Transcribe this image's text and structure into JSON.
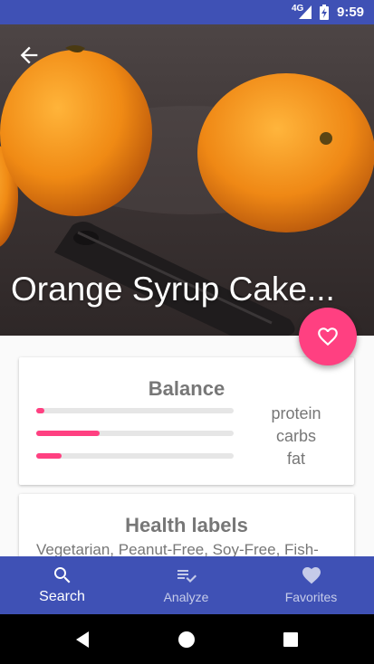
{
  "status_bar": {
    "network": "4G",
    "time": "9:59"
  },
  "recipe": {
    "title": "Orange Syrup Cake..."
  },
  "balance": {
    "title": "Balance",
    "nutrients": [
      {
        "label": "protein",
        "fraction": 0.04
      },
      {
        "label": "carbs",
        "fraction": 0.32
      },
      {
        "label": "fat",
        "fraction": 0.13
      }
    ],
    "accent_color": "#ff4081"
  },
  "health": {
    "title": "Health labels",
    "text": "Vegetarian, Peanut-Free, Soy-Free, Fish-"
  },
  "bottom_nav": {
    "items": [
      {
        "label": "Search",
        "icon": "search-icon",
        "active": true
      },
      {
        "label": "Analyze",
        "icon": "playlist-check-icon",
        "active": false
      },
      {
        "label": "Favorites",
        "icon": "heart-icon",
        "active": false
      }
    ]
  },
  "colors": {
    "primary": "#3f51b5",
    "accent": "#ff4081"
  }
}
